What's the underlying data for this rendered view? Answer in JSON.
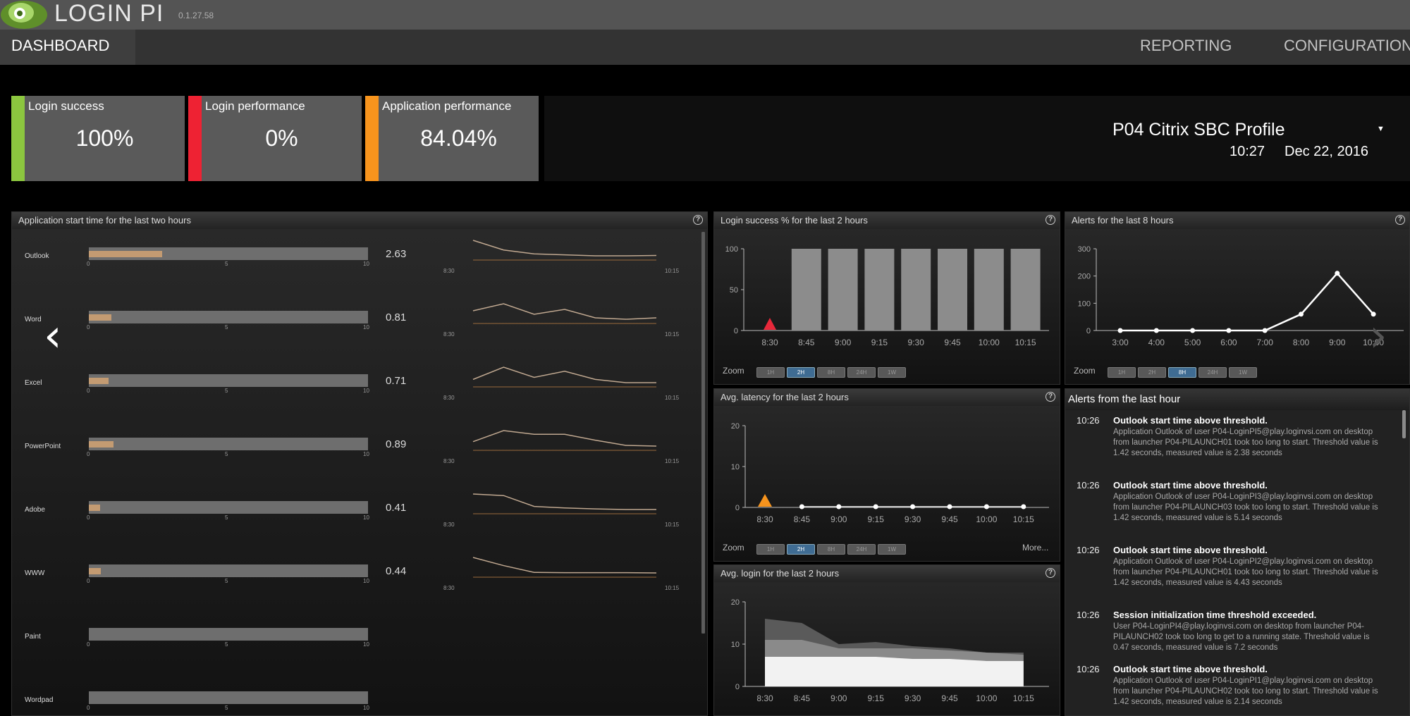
{
  "header": {
    "brand": "LOGIN PI",
    "version": "0.1.27.58"
  },
  "nav": {
    "dashboard": "DASHBOARD",
    "reporting": "REPORTING",
    "configuration": "CONFIGURATION"
  },
  "kpis": [
    {
      "label": "Login success",
      "value": "100%",
      "color": "#8cc63f"
    },
    {
      "label": "Login performance",
      "value": "0%",
      "color": "#ee2233"
    },
    {
      "label": "Application performance",
      "value": "84.04%",
      "color": "#f7941d"
    }
  ],
  "profile": {
    "name": "P04 Citrix SBC Profile",
    "time": "10:27",
    "date": "Dec 22, 2016"
  },
  "app_start": {
    "title": "Application start time for the last two hours",
    "axis_ticks": [
      "0",
      "5",
      "10"
    ],
    "spark_start": "8:30",
    "spark_end": "10:15",
    "apps": [
      {
        "name": "Outlook",
        "value": "2.63",
        "num": 2.63,
        "spark": [
          3.4,
          2.9,
          2.7,
          2.65,
          2.6,
          2.6,
          2.62
        ]
      },
      {
        "name": "Word",
        "value": "0.81",
        "num": 0.81,
        "spark": [
          0.9,
          1.0,
          0.85,
          0.92,
          0.8,
          0.78,
          0.8
        ]
      },
      {
        "name": "Excel",
        "value": "0.71",
        "num": 0.71,
        "spark": [
          0.8,
          1.1,
          0.85,
          1.0,
          0.8,
          0.72,
          0.72
        ]
      },
      {
        "name": "PowerPoint",
        "value": "0.89",
        "num": 0.89,
        "spark": [
          0.9,
          1.05,
          1.0,
          1.0,
          0.92,
          0.85,
          0.84
        ]
      },
      {
        "name": "Adobe",
        "value": "0.41",
        "num": 0.41,
        "spark": [
          0.9,
          0.85,
          0.5,
          0.45,
          0.42,
          0.4,
          0.4
        ]
      },
      {
        "name": "WWW",
        "value": "0.44",
        "num": 0.44,
        "spark": [
          1.0,
          0.7,
          0.45,
          0.44,
          0.44,
          0.44,
          0.43
        ]
      },
      {
        "name": "Paint",
        "value": "",
        "num": 0,
        "spark": []
      },
      {
        "name": "Wordpad",
        "value": "",
        "num": 0,
        "spark": []
      }
    ]
  },
  "zoom": {
    "label": "Zoom",
    "buttons": [
      "1H",
      "2H",
      "8H",
      "24H",
      "1W"
    ]
  },
  "login_success": {
    "title": "Login success % for the last 2 hours",
    "chart_data": {
      "type": "bar",
      "categories": [
        "8:30",
        "8:45",
        "9:00",
        "9:15",
        "9:30",
        "9:45",
        "10:00",
        "10:15"
      ],
      "values": [
        0,
        100,
        100,
        100,
        100,
        100,
        100,
        100
      ],
      "yticks": [
        "0",
        "50",
        "100"
      ],
      "ylim": [
        0,
        100
      ]
    },
    "zoom_active": 1
  },
  "alerts_8h": {
    "title": "Alerts for the last 8 hours",
    "chart_data": {
      "type": "line",
      "categories": [
        "3:00",
        "4:00",
        "5:00",
        "6:00",
        "7:00",
        "8:00",
        "9:00",
        "10:00"
      ],
      "values": [
        0,
        0,
        0,
        0,
        0,
        60,
        210,
        60
      ],
      "yticks": [
        "0",
        "100",
        "200",
        "300"
      ],
      "ylim": [
        0,
        300
      ]
    },
    "zoom_active": 2
  },
  "latency": {
    "title": "Avg. latency for the last 2 hours",
    "more": "More...",
    "chart_data": {
      "type": "line",
      "categories": [
        "8:30",
        "8:45",
        "9:00",
        "9:15",
        "9:30",
        "9:45",
        "10:00",
        "10:15"
      ],
      "values": [
        1,
        0,
        0,
        0,
        0,
        0,
        0,
        0
      ],
      "yticks": [
        "0",
        "10",
        "20"
      ],
      "ylim": [
        0,
        20
      ]
    },
    "zoom_active": 1
  },
  "avg_login": {
    "title": "Avg. login for the last 2 hours",
    "chart_data": {
      "type": "area",
      "categories": [
        "8:30",
        "8:45",
        "9:00",
        "9:15",
        "9:30",
        "9:45",
        "10:00",
        "10:15"
      ],
      "series": [
        {
          "values": [
            7,
            7,
            7,
            7,
            6.5,
            6.5,
            6,
            6
          ]
        },
        {
          "values": [
            11,
            11,
            9,
            9,
            9,
            8.5,
            8,
            7.5
          ]
        },
        {
          "values": [
            16,
            15,
            10,
            10.5,
            9.5,
            9,
            8,
            8
          ]
        }
      ],
      "yticks": [
        "0",
        "10",
        "20"
      ],
      "ylim": [
        0,
        20
      ]
    }
  },
  "alerts_hour": {
    "title": "Alerts from the last hour",
    "items": [
      {
        "time": "10:26",
        "title": "Outlook start time above threshold.",
        "body": "Application Outlook of user P04-LoginPI5@play.loginvsi.com on desktop from launcher P04-PILAUNCH01 took too long to start. Threshold value is 1.42 seconds, measured value is 2.38 seconds"
      },
      {
        "time": "10:26",
        "title": "Outlook start time above threshold.",
        "body": "Application Outlook of user P04-LoginPI3@play.loginvsi.com on desktop from launcher P04-PILAUNCH03 took too long to start. Threshold value is 1.42 seconds, measured value is 5.14 seconds"
      },
      {
        "time": "10:26",
        "title": "Outlook start time above threshold.",
        "body": "Application Outlook of user P04-LoginPI2@play.loginvsi.com on desktop from launcher P04-PILAUNCH01 took too long to start. Threshold value is 1.42 seconds, measured value is 4.43 seconds"
      },
      {
        "time": "10:26",
        "title": "Session initialization time threshold exceeded.",
        "body": "User P04-LoginPI4@play.loginvsi.com on desktop from launcher P04-PILAUNCH02 took too long to get to a running state. Threshold value is 0.47 seconds, measured value is 7.2 seconds"
      },
      {
        "time": "10:26",
        "title": "Outlook start time above threshold.",
        "body": "Application Outlook of user P04-LoginPI1@play.loginvsi.com on desktop from launcher P04-PILAUNCH02 took too long to start. Threshold value is 1.42 seconds, measured value is 2.14 seconds"
      }
    ]
  },
  "carousel": {
    "prev": "‹",
    "next": "›"
  }
}
